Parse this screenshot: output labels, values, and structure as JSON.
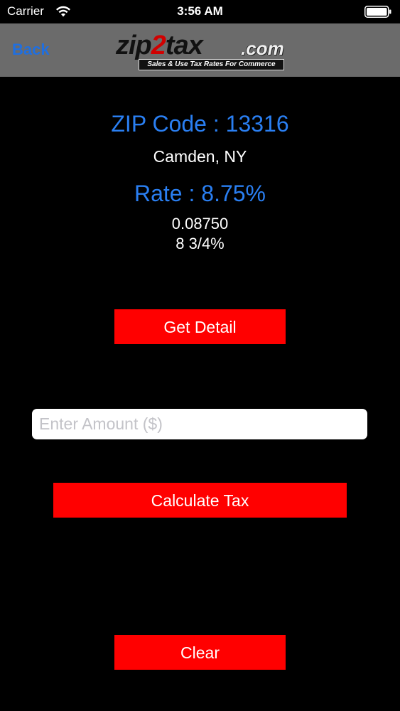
{
  "status_bar": {
    "carrier": "Carrier",
    "time": "3:56 AM"
  },
  "nav": {
    "back_label": "Back",
    "logo": {
      "main_prefix": "zip",
      "main_two": "2",
      "main_suffix": "tax",
      "dotcom": ".com",
      "tagline": "Sales & Use Tax Rates For Commerce"
    }
  },
  "result": {
    "zip_title": "ZIP Code : 13316",
    "city": "Camden, NY",
    "rate_title": "Rate : 8.75%",
    "rate_decimal": "0.08750",
    "rate_fraction": "8 3/4%"
  },
  "actions": {
    "get_detail_label": "Get Detail",
    "calculate_label": "Calculate Tax",
    "clear_label": "Clear"
  },
  "amount_input": {
    "placeholder": "Enter Amount ($)",
    "value": ""
  },
  "colors": {
    "accent_blue": "#2a7ff2",
    "button_red": "#ff0000",
    "nav_gray": "#6b6b6b"
  }
}
